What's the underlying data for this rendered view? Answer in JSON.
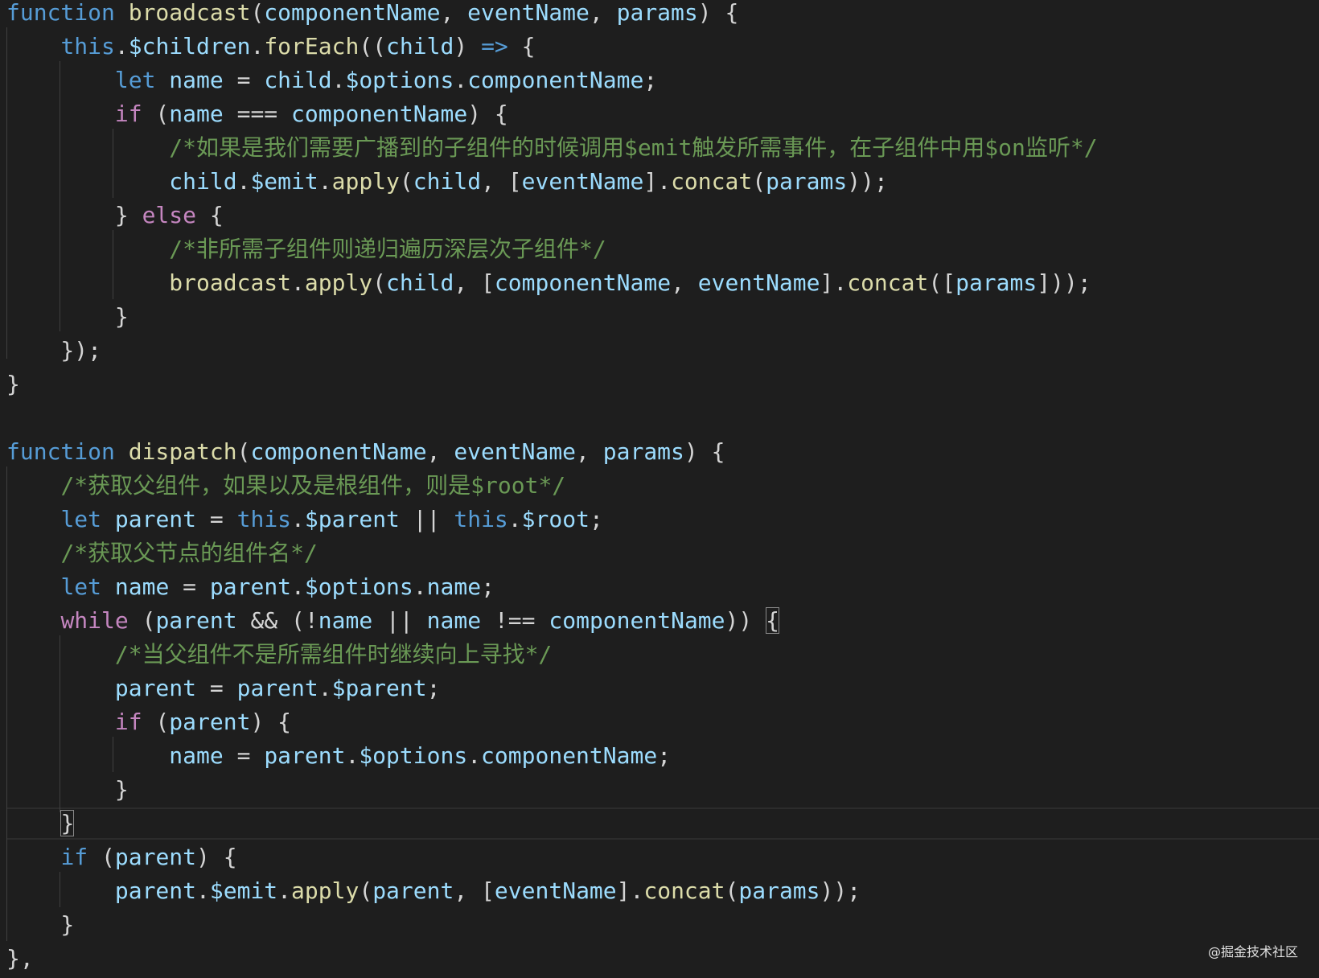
{
  "editor": {
    "theme_colors": {
      "background": "#1e1e1e",
      "keyword_storage": "#569cd6",
      "keyword_control": "#c586c0",
      "function_name": "#dcdcaa",
      "variable": "#9cdcfe",
      "comment": "#6a9955",
      "punctuation": "#d4d4d4"
    },
    "lines": [
      [
        {
          "t": "function",
          "c": "#569cd6"
        },
        {
          "t": " ",
          "c": "#d4d4d4"
        },
        {
          "t": "broadcast",
          "c": "#dcdcaa"
        },
        {
          "t": "(",
          "c": "#d4d4d4"
        },
        {
          "t": "componentName",
          "c": "#9cdcfe"
        },
        {
          "t": ", ",
          "c": "#d4d4d4"
        },
        {
          "t": "eventName",
          "c": "#9cdcfe"
        },
        {
          "t": ", ",
          "c": "#d4d4d4"
        },
        {
          "t": "params",
          "c": "#9cdcfe"
        },
        {
          "t": ") {",
          "c": "#d4d4d4"
        }
      ],
      [
        {
          "t": "    ",
          "c": "#d4d4d4"
        },
        {
          "t": "this",
          "c": "#569cd6"
        },
        {
          "t": ".",
          "c": "#d4d4d4"
        },
        {
          "t": "$children",
          "c": "#9cdcfe"
        },
        {
          "t": ".",
          "c": "#d4d4d4"
        },
        {
          "t": "forEach",
          "c": "#dcdcaa"
        },
        {
          "t": "((",
          "c": "#d4d4d4"
        },
        {
          "t": "child",
          "c": "#9cdcfe"
        },
        {
          "t": ") ",
          "c": "#d4d4d4"
        },
        {
          "t": "=>",
          "c": "#569cd6"
        },
        {
          "t": " {",
          "c": "#d4d4d4"
        }
      ],
      [
        {
          "t": "        ",
          "c": "#d4d4d4"
        },
        {
          "t": "let",
          "c": "#569cd6"
        },
        {
          "t": " ",
          "c": "#d4d4d4"
        },
        {
          "t": "name",
          "c": "#9cdcfe"
        },
        {
          "t": " = ",
          "c": "#d4d4d4"
        },
        {
          "t": "child",
          "c": "#9cdcfe"
        },
        {
          "t": ".",
          "c": "#d4d4d4"
        },
        {
          "t": "$options",
          "c": "#9cdcfe"
        },
        {
          "t": ".",
          "c": "#d4d4d4"
        },
        {
          "t": "componentName",
          "c": "#9cdcfe"
        },
        {
          "t": ";",
          "c": "#d4d4d4"
        }
      ],
      [
        {
          "t": "        ",
          "c": "#d4d4d4"
        },
        {
          "t": "if",
          "c": "#c586c0"
        },
        {
          "t": " (",
          "c": "#d4d4d4"
        },
        {
          "t": "name",
          "c": "#9cdcfe"
        },
        {
          "t": " === ",
          "c": "#d4d4d4"
        },
        {
          "t": "componentName",
          "c": "#9cdcfe"
        },
        {
          "t": ") {",
          "c": "#d4d4d4"
        }
      ],
      [
        {
          "t": "            ",
          "c": "#d4d4d4"
        },
        {
          "t": "/*如果是我们需要广播到的子组件的时候调用$emit触发所需事件，在子组件中用$on监听*/",
          "c": "#6a9955"
        }
      ],
      [
        {
          "t": "            ",
          "c": "#d4d4d4"
        },
        {
          "t": "child",
          "c": "#9cdcfe"
        },
        {
          "t": ".",
          "c": "#d4d4d4"
        },
        {
          "t": "$emit",
          "c": "#9cdcfe"
        },
        {
          "t": ".",
          "c": "#d4d4d4"
        },
        {
          "t": "apply",
          "c": "#dcdcaa"
        },
        {
          "t": "(",
          "c": "#d4d4d4"
        },
        {
          "t": "child",
          "c": "#9cdcfe"
        },
        {
          "t": ", [",
          "c": "#d4d4d4"
        },
        {
          "t": "eventName",
          "c": "#9cdcfe"
        },
        {
          "t": "].",
          "c": "#d4d4d4"
        },
        {
          "t": "concat",
          "c": "#dcdcaa"
        },
        {
          "t": "(",
          "c": "#d4d4d4"
        },
        {
          "t": "params",
          "c": "#9cdcfe"
        },
        {
          "t": "));",
          "c": "#d4d4d4"
        }
      ],
      [
        {
          "t": "        } ",
          "c": "#d4d4d4"
        },
        {
          "t": "else",
          "c": "#c586c0"
        },
        {
          "t": " {",
          "c": "#d4d4d4"
        }
      ],
      [
        {
          "t": "            ",
          "c": "#d4d4d4"
        },
        {
          "t": "/*非所需子组件则递归遍历深层次子组件*/",
          "c": "#6a9955"
        }
      ],
      [
        {
          "t": "            ",
          "c": "#d4d4d4"
        },
        {
          "t": "broadcast",
          "c": "#dcdcaa"
        },
        {
          "t": ".",
          "c": "#d4d4d4"
        },
        {
          "t": "apply",
          "c": "#dcdcaa"
        },
        {
          "t": "(",
          "c": "#d4d4d4"
        },
        {
          "t": "child",
          "c": "#9cdcfe"
        },
        {
          "t": ", [",
          "c": "#d4d4d4"
        },
        {
          "t": "componentName",
          "c": "#9cdcfe"
        },
        {
          "t": ", ",
          "c": "#d4d4d4"
        },
        {
          "t": "eventName",
          "c": "#9cdcfe"
        },
        {
          "t": "].",
          "c": "#d4d4d4"
        },
        {
          "t": "concat",
          "c": "#dcdcaa"
        },
        {
          "t": "([",
          "c": "#d4d4d4"
        },
        {
          "t": "params",
          "c": "#9cdcfe"
        },
        {
          "t": "]));",
          "c": "#d4d4d4"
        }
      ],
      [
        {
          "t": "        }",
          "c": "#d4d4d4"
        }
      ],
      [
        {
          "t": "    });",
          "c": "#d4d4d4"
        }
      ],
      [
        {
          "t": "}",
          "c": "#d4d4d4"
        }
      ],
      [],
      [
        {
          "t": "function",
          "c": "#569cd6"
        },
        {
          "t": " ",
          "c": "#d4d4d4"
        },
        {
          "t": "dispatch",
          "c": "#dcdcaa"
        },
        {
          "t": "(",
          "c": "#d4d4d4"
        },
        {
          "t": "componentName",
          "c": "#9cdcfe"
        },
        {
          "t": ", ",
          "c": "#d4d4d4"
        },
        {
          "t": "eventName",
          "c": "#9cdcfe"
        },
        {
          "t": ", ",
          "c": "#d4d4d4"
        },
        {
          "t": "params",
          "c": "#9cdcfe"
        },
        {
          "t": ") {",
          "c": "#d4d4d4"
        }
      ],
      [
        {
          "t": "    ",
          "c": "#d4d4d4"
        },
        {
          "t": "/*获取父组件，如果以及是根组件，则是$root*/",
          "c": "#6a9955"
        }
      ],
      [
        {
          "t": "    ",
          "c": "#d4d4d4"
        },
        {
          "t": "let",
          "c": "#569cd6"
        },
        {
          "t": " ",
          "c": "#d4d4d4"
        },
        {
          "t": "parent",
          "c": "#9cdcfe"
        },
        {
          "t": " = ",
          "c": "#d4d4d4"
        },
        {
          "t": "this",
          "c": "#569cd6"
        },
        {
          "t": ".",
          "c": "#d4d4d4"
        },
        {
          "t": "$parent",
          "c": "#9cdcfe"
        },
        {
          "t": " || ",
          "c": "#d4d4d4"
        },
        {
          "t": "this",
          "c": "#569cd6"
        },
        {
          "t": ".",
          "c": "#d4d4d4"
        },
        {
          "t": "$root",
          "c": "#9cdcfe"
        },
        {
          "t": ";",
          "c": "#d4d4d4"
        }
      ],
      [
        {
          "t": "    ",
          "c": "#d4d4d4"
        },
        {
          "t": "/*获取父节点的组件名*/",
          "c": "#6a9955"
        }
      ],
      [
        {
          "t": "    ",
          "c": "#d4d4d4"
        },
        {
          "t": "let",
          "c": "#569cd6"
        },
        {
          "t": " ",
          "c": "#d4d4d4"
        },
        {
          "t": "name",
          "c": "#9cdcfe"
        },
        {
          "t": " = ",
          "c": "#d4d4d4"
        },
        {
          "t": "parent",
          "c": "#9cdcfe"
        },
        {
          "t": ".",
          "c": "#d4d4d4"
        },
        {
          "t": "$options",
          "c": "#9cdcfe"
        },
        {
          "t": ".",
          "c": "#d4d4d4"
        },
        {
          "t": "name",
          "c": "#9cdcfe"
        },
        {
          "t": ";",
          "c": "#d4d4d4"
        }
      ],
      [
        {
          "t": "    ",
          "c": "#d4d4d4"
        },
        {
          "t": "while",
          "c": "#c586c0"
        },
        {
          "t": " (",
          "c": "#d4d4d4"
        },
        {
          "t": "parent",
          "c": "#9cdcfe"
        },
        {
          "t": " && (!",
          "c": "#d4d4d4"
        },
        {
          "t": "name",
          "c": "#9cdcfe"
        },
        {
          "t": " || ",
          "c": "#d4d4d4"
        },
        {
          "t": "name",
          "c": "#9cdcfe"
        },
        {
          "t": " !== ",
          "c": "#d4d4d4"
        },
        {
          "t": "componentName",
          "c": "#9cdcfe"
        },
        {
          "t": ")) ",
          "c": "#d4d4d4"
        },
        {
          "t": "{",
          "c": "#d4d4d4",
          "box": true
        }
      ],
      [
        {
          "t": "        ",
          "c": "#d4d4d4"
        },
        {
          "t": "/*当父组件不是所需组件时继续向上寻找*/",
          "c": "#6a9955"
        }
      ],
      [
        {
          "t": "        ",
          "c": "#d4d4d4"
        },
        {
          "t": "parent",
          "c": "#9cdcfe"
        },
        {
          "t": " = ",
          "c": "#d4d4d4"
        },
        {
          "t": "parent",
          "c": "#9cdcfe"
        },
        {
          "t": ".",
          "c": "#d4d4d4"
        },
        {
          "t": "$parent",
          "c": "#9cdcfe"
        },
        {
          "t": ";",
          "c": "#d4d4d4"
        }
      ],
      [
        {
          "t": "        ",
          "c": "#d4d4d4"
        },
        {
          "t": "if",
          "c": "#c586c0"
        },
        {
          "t": " (",
          "c": "#d4d4d4"
        },
        {
          "t": "parent",
          "c": "#9cdcfe"
        },
        {
          "t": ") {",
          "c": "#d4d4d4"
        }
      ],
      [
        {
          "t": "            ",
          "c": "#d4d4d4"
        },
        {
          "t": "name",
          "c": "#9cdcfe"
        },
        {
          "t": " = ",
          "c": "#d4d4d4"
        },
        {
          "t": "parent",
          "c": "#9cdcfe"
        },
        {
          "t": ".",
          "c": "#d4d4d4"
        },
        {
          "t": "$options",
          "c": "#9cdcfe"
        },
        {
          "t": ".",
          "c": "#d4d4d4"
        },
        {
          "t": "componentName",
          "c": "#9cdcfe"
        },
        {
          "t": ";",
          "c": "#d4d4d4"
        }
      ],
      [
        {
          "t": "        }",
          "c": "#d4d4d4"
        }
      ],
      [
        {
          "t": "    ",
          "c": "#d4d4d4"
        },
        {
          "t": "}",
          "c": "#d4d4d4",
          "box": true
        }
      ],
      [
        {
          "t": "    ",
          "c": "#d4d4d4"
        },
        {
          "t": "if",
          "c": "#569cd6"
        },
        {
          "t": " (",
          "c": "#d4d4d4"
        },
        {
          "t": "parent",
          "c": "#9cdcfe"
        },
        {
          "t": ") {",
          "c": "#d4d4d4"
        }
      ],
      [
        {
          "t": "        ",
          "c": "#d4d4d4"
        },
        {
          "t": "parent",
          "c": "#9cdcfe"
        },
        {
          "t": ".",
          "c": "#d4d4d4"
        },
        {
          "t": "$emit",
          "c": "#9cdcfe"
        },
        {
          "t": ".",
          "c": "#d4d4d4"
        },
        {
          "t": "apply",
          "c": "#dcdcaa"
        },
        {
          "t": "(",
          "c": "#d4d4d4"
        },
        {
          "t": "parent",
          "c": "#9cdcfe"
        },
        {
          "t": ", [",
          "c": "#d4d4d4"
        },
        {
          "t": "eventName",
          "c": "#9cdcfe"
        },
        {
          "t": "].",
          "c": "#d4d4d4"
        },
        {
          "t": "concat",
          "c": "#dcdcaa"
        },
        {
          "t": "(",
          "c": "#d4d4d4"
        },
        {
          "t": "params",
          "c": "#9cdcfe"
        },
        {
          "t": "));",
          "c": "#d4d4d4"
        }
      ],
      [
        {
          "t": "    }",
          "c": "#d4d4d4"
        }
      ],
      [
        {
          "t": "},",
          "c": "#d4d4d4"
        }
      ]
    ]
  },
  "watermark": "@掘金技术社区"
}
